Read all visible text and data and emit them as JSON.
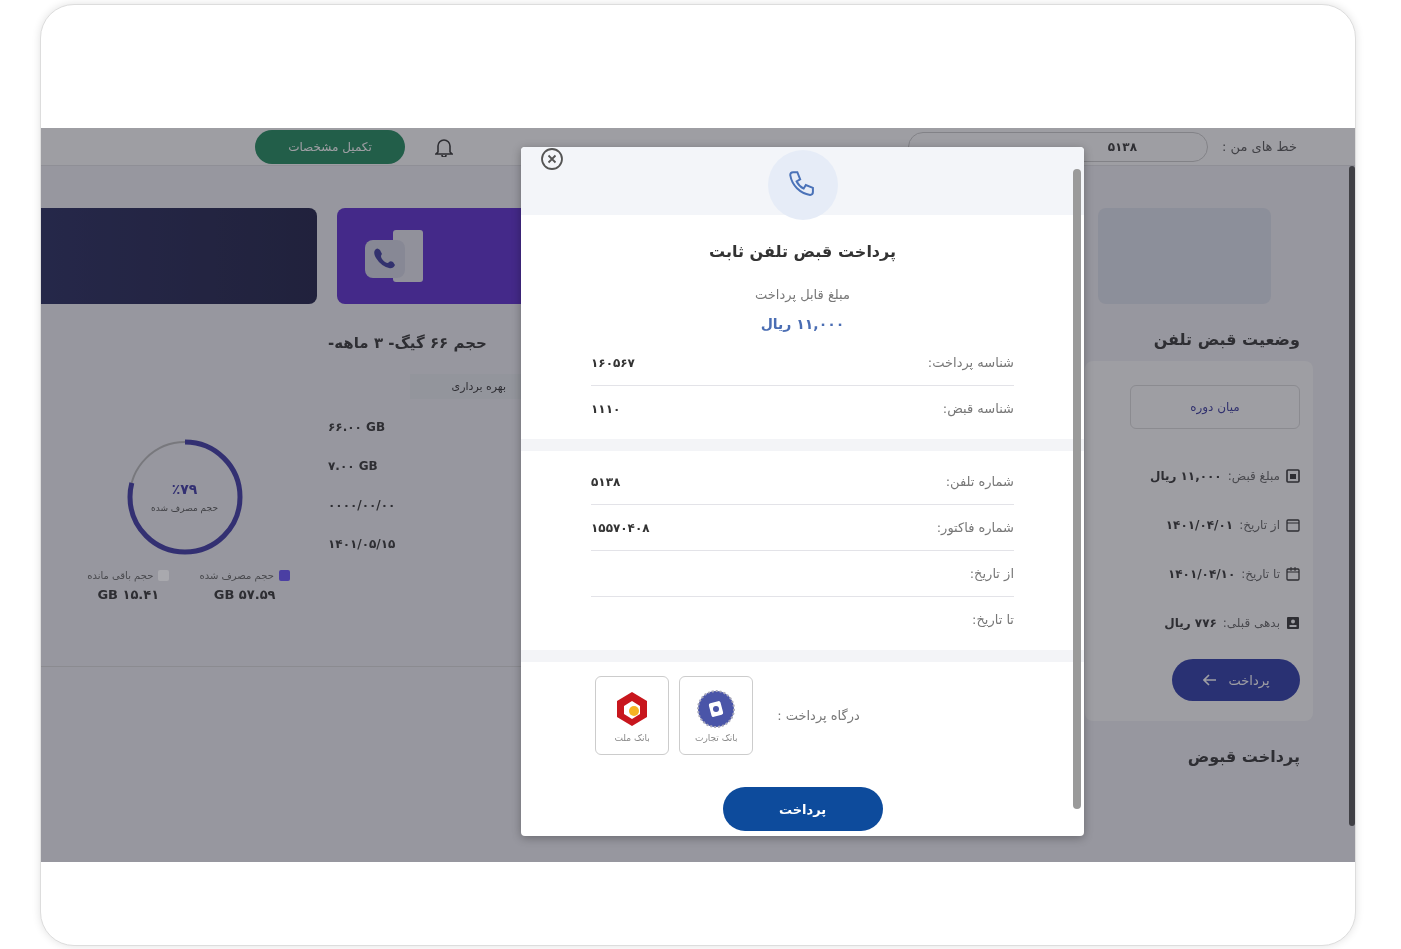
{
  "header": {
    "complete_profile_button": "تکمیل مشخصات",
    "lines_label": "خط های من :",
    "line_number": "۵۱۳۸"
  },
  "plan": {
    "title": "حجم ۶۶ گیگ- ۳ ماهه-",
    "chip": "بهره برداری",
    "values": [
      "۶۶.۰۰ GB",
      "۷.۰۰ GB",
      "۰۰۰۰/۰۰/۰۰",
      "۱۴۰۱/۰۵/۱۵"
    ],
    "usage": {
      "level": 0.79,
      "percent": "٪۷۹",
      "caption": "حجم مصرف شده"
    },
    "legend": [
      {
        "label": "حجم مصرف شده",
        "value": "۵۷.۵۹ GB",
        "color": "#4b3fa3"
      },
      {
        "label": "حجم باقی مانده",
        "value": "۱۵.۴۱ GB",
        "color": "#a9a9ae"
      }
    ]
  },
  "status": {
    "title": "وضعیت قبض تلفن",
    "period_button": "میان دوره",
    "rows": [
      {
        "kind": "bill",
        "label": "مبلغ قبض:",
        "value": "۱۱,۰۰۰ ریال"
      },
      {
        "kind": "start",
        "label": "از تاریخ:",
        "value": "۱۴۰۱/۰۴/۰۱"
      },
      {
        "kind": "end",
        "label": "تا تاریخ:",
        "value": "۱۴۰۱/۰۴/۱۰"
      },
      {
        "kind": "debt",
        "label": "بدهی قبلی:",
        "value": "۷۷۶ ریال"
      }
    ],
    "pay_button": "پرداخت"
  },
  "bills_title": "پرداخت قبوض",
  "modal": {
    "title": "پرداخت قبض تلفن ثابت",
    "amount_label": "مبلغ قابل پرداخت",
    "amount": "۱۱,۰۰۰ ریال",
    "sections": [
      [
        {
          "label": "شناسه پرداخت:",
          "value": "۱۶۰۵۶۷"
        },
        {
          "label": "شناسه قبض:",
          "value": "۱۱۱۰"
        }
      ],
      [
        {
          "label": "شماره تلفن:",
          "value": "۵۱۳۸"
        },
        {
          "label": "شماره فاکتور:",
          "value": "۱۵۵۷۰۴۰۸"
        },
        {
          "label": "از تاریخ:"
        },
        {
          "label": "تا تاریخ:"
        }
      ]
    ],
    "gateway_label": "درگاه پرداخت :",
    "banks": [
      {
        "kind": "tejarat",
        "name": "بانک تجارت"
      },
      {
        "kind": "mellat",
        "name": "بانک ملت"
      }
    ],
    "pay_button": "پرداخت"
  }
}
